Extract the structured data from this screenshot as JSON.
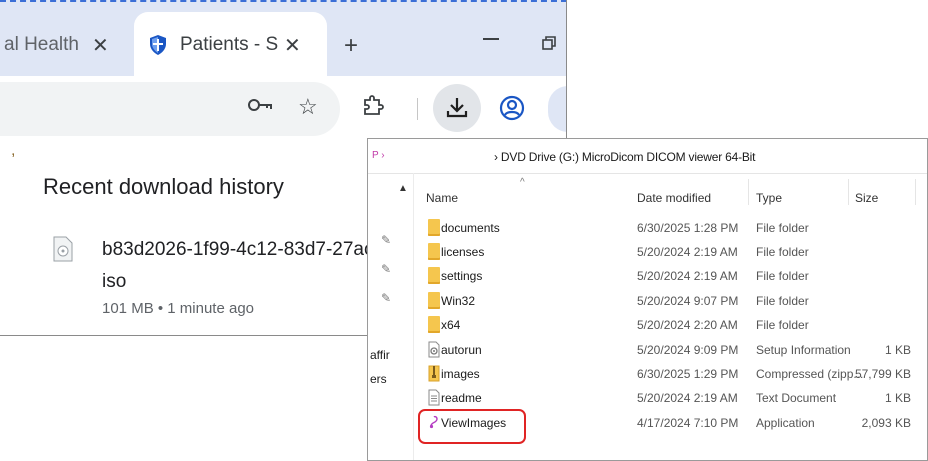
{
  "browser": {
    "tabs": [
      {
        "title": "al Health",
        "close": "✕"
      },
      {
        "title": "Patients - Su",
        "close": "✕"
      }
    ],
    "new_tab": "+",
    "star": "☆",
    "downloads": {
      "heading": "Recent download history",
      "item": {
        "filename": "b83d2026-1f99-4c12-83d7-27ac.iso",
        "meta": "101 MB • 1 minute ago"
      }
    },
    "colors": {
      "tabstrip": "#dfe6f5",
      "accent": "#3c6fd6"
    }
  },
  "explorer": {
    "path": "› DVD Drive (G:) MicroDicom DICOM viewer 64-Bit",
    "nav": "P ›",
    "columns": {
      "name": "Name",
      "date": "Date modified",
      "type": "Type",
      "size": "Size"
    },
    "sidebar_labels": [
      "affir",
      "ers"
    ],
    "files": [
      {
        "name": "documents",
        "date": "6/30/2025 1:28 PM",
        "type": "File folder",
        "size": "",
        "icon": "folder-icon"
      },
      {
        "name": "licenses",
        "date": "5/20/2024 2:19 AM",
        "type": "File folder",
        "size": "",
        "icon": "folder-icon"
      },
      {
        "name": "settings",
        "date": "5/20/2024 2:19 AM",
        "type": "File folder",
        "size": "",
        "icon": "folder-icon"
      },
      {
        "name": "Win32",
        "date": "5/20/2024 9:07 PM",
        "type": "File folder",
        "size": "",
        "icon": "folder-icon"
      },
      {
        "name": "x64",
        "date": "5/20/2024 2:20 AM",
        "type": "File folder",
        "size": "",
        "icon": "folder-icon"
      },
      {
        "name": "autorun",
        "date": "5/20/2024 9:09 PM",
        "type": "Setup Information",
        "size": "1 KB",
        "icon": "setup-file-icon"
      },
      {
        "name": "images",
        "date": "6/30/2025 1:29 PM",
        "type": "Compressed (zipp...",
        "size": "57,799 KB",
        "icon": "zip-icon"
      },
      {
        "name": "readme",
        "date": "5/20/2024 2:19 AM",
        "type": "Text Document",
        "size": "1 KB",
        "icon": "text-file-icon"
      },
      {
        "name": "ViewImages",
        "date": "4/17/2024 7:10 PM",
        "type": "Application",
        "size": "2,093 KB",
        "icon": "application-icon"
      }
    ],
    "highlight_color": "#e02424"
  }
}
